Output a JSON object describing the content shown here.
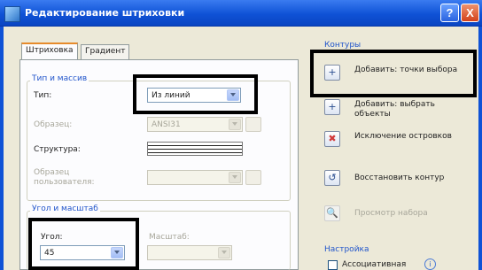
{
  "window": {
    "title": "Редактирование штриховки",
    "help_label": "?",
    "close_label": "X"
  },
  "tabs": [
    {
      "label": "Штриховка",
      "active": true
    },
    {
      "label": "Градиент",
      "active": false
    }
  ],
  "type_group": {
    "title": "Тип и массив",
    "type_label": "Тип:",
    "type_value": "Из линий",
    "sample_label": "Образец:",
    "sample_value": "ANSI31",
    "structure_label": "Структура:",
    "custom_label": "Образец пользователя:"
  },
  "angle_group": {
    "title": "Угол и масштаб",
    "angle_label": "Угол:",
    "angle_value": "45",
    "scale_label": "Масштаб:"
  },
  "contours": {
    "title": "Контуры",
    "actions": [
      {
        "label": "Добавить: точки выбора",
        "icon": "pick-points-icon",
        "glyph": "+",
        "enabled": true
      },
      {
        "label": "Добавить: выбрать объекты",
        "icon": "select-objects-icon",
        "glyph": "+",
        "enabled": true
      },
      {
        "label": "Исключение островков",
        "icon": "remove-islands-icon",
        "glyph": "✖",
        "enabled": true
      },
      {
        "label": "Восстановить контур",
        "icon": "recreate-boundary-icon",
        "glyph": "↺",
        "enabled": true
      },
      {
        "label": "Просмотр набора",
        "icon": "view-selection-icon",
        "glyph": "🔍",
        "enabled": false
      }
    ]
  },
  "settings": {
    "title": "Настройка",
    "associative_label": "Ассоциативная",
    "info_glyph": "i"
  },
  "colors": {
    "titlebar": "#0f52d6",
    "highlight": "#000000",
    "group_title": "#2155cb"
  }
}
